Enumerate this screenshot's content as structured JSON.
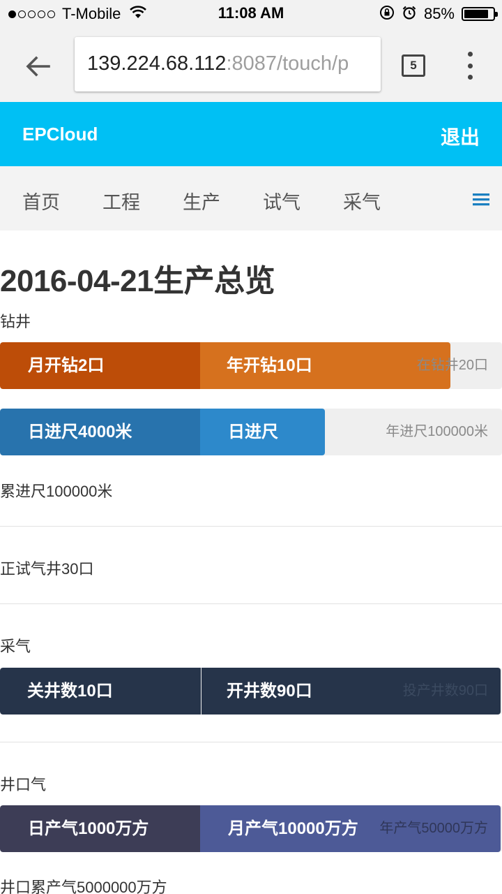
{
  "status_bar": {
    "carrier": "T-Mobile",
    "time": "11:08 AM",
    "battery": "85%",
    "battery_level": 0.85,
    "signal_dots_filled": 1,
    "signal_dots_total": 5,
    "icons": [
      "wifi-icon",
      "orientation-lock-icon",
      "alarm-icon",
      "battery-icon"
    ]
  },
  "browser": {
    "url_host": "139.224.68.112",
    "url_path": ":8087/touch/p",
    "tab_count": "5",
    "icons": [
      "back-arrow-icon",
      "overflow-menu-icon"
    ]
  },
  "app": {
    "brand": "EPCloud",
    "logout": "退出",
    "header_color": "#00c0f4"
  },
  "nav": {
    "items": [
      "首页",
      "工程",
      "生产",
      "试气",
      "采气"
    ],
    "menu_icon": "hamburger-icon",
    "menu_icon_color": "#1a7fc1"
  },
  "page": {
    "title": "2016-04-21生产总览"
  },
  "drilling": {
    "section_label": "钻井",
    "bar1": {
      "seg1": "月开钻2口",
      "seg2": "年开钻10口",
      "end": "在钻井20口",
      "colors": [
        "#bd4d08",
        "#d6711e"
      ],
      "fill_fraction": [
        0.4,
        0.5
      ]
    },
    "bar2": {
      "seg1": "日进尺4000米",
      "seg2": "日进尺",
      "end": "年进尺100000米",
      "colors": [
        "#2873ad",
        "#2d89cb"
      ],
      "fill_fraction": [
        0.4,
        0.25
      ]
    },
    "cumulative": "累进尺100000米"
  },
  "testing": {
    "label": "正试气井30口"
  },
  "gas_production": {
    "section_label": "采气",
    "bar": {
      "seg1": "关井数10口",
      "seg2": "开井数90口",
      "end": "投产井数90口",
      "colors": [
        "#26344a",
        "#26344a"
      ],
      "fill_fraction": [
        0.4,
        0.6
      ]
    }
  },
  "wellhead_gas": {
    "section_label": "井口气",
    "bar": {
      "seg1": "日产气1000万方",
      "seg2": "月产气10000万方",
      "end": "年产气50000万方",
      "colors": [
        "#3d3d56",
        "#4d5a97"
      ],
      "fill_fraction": [
        0.4,
        0.6
      ]
    },
    "cumulative": "井口累产气5000000万方"
  }
}
